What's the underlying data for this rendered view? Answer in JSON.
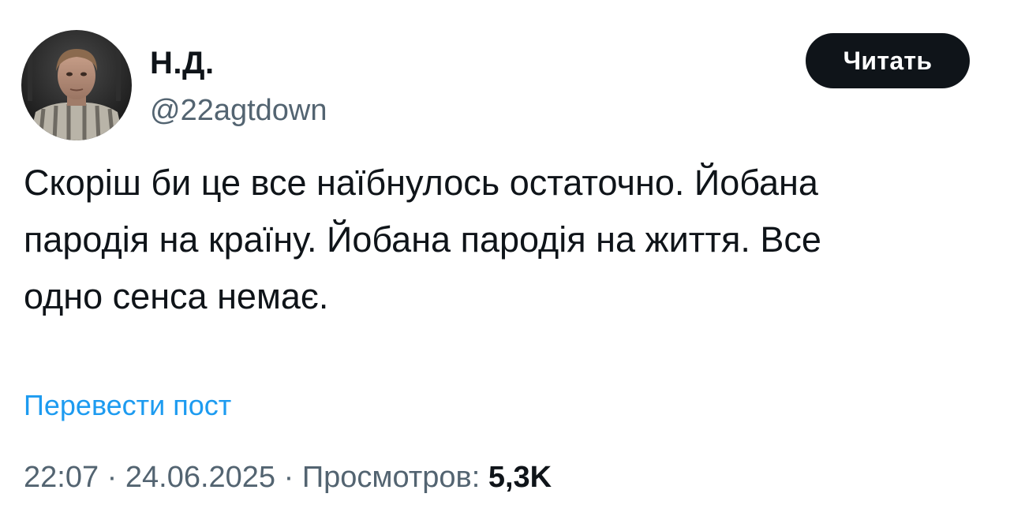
{
  "author": {
    "display_name": "Н.Д.",
    "handle": "@22agtdown"
  },
  "follow_button": {
    "label": "Читать"
  },
  "tweet": {
    "text_lines": [
      "Скоріш би це все наїбнулось остаточно. Йобана",
      "пародія на країну. Йобана пародія на життя. Все",
      "одно сенса немає."
    ]
  },
  "translate": {
    "label": "Перевести пост"
  },
  "meta": {
    "time": "22:07",
    "separator": " · ",
    "date": "24.06.2025",
    "views_label": "Просмотров:",
    "views_count": "5,3K"
  },
  "colors": {
    "text_primary": "#0f1419",
    "text_secondary": "#536471",
    "link": "#1d9bf0",
    "button_bg": "#0f1419"
  }
}
